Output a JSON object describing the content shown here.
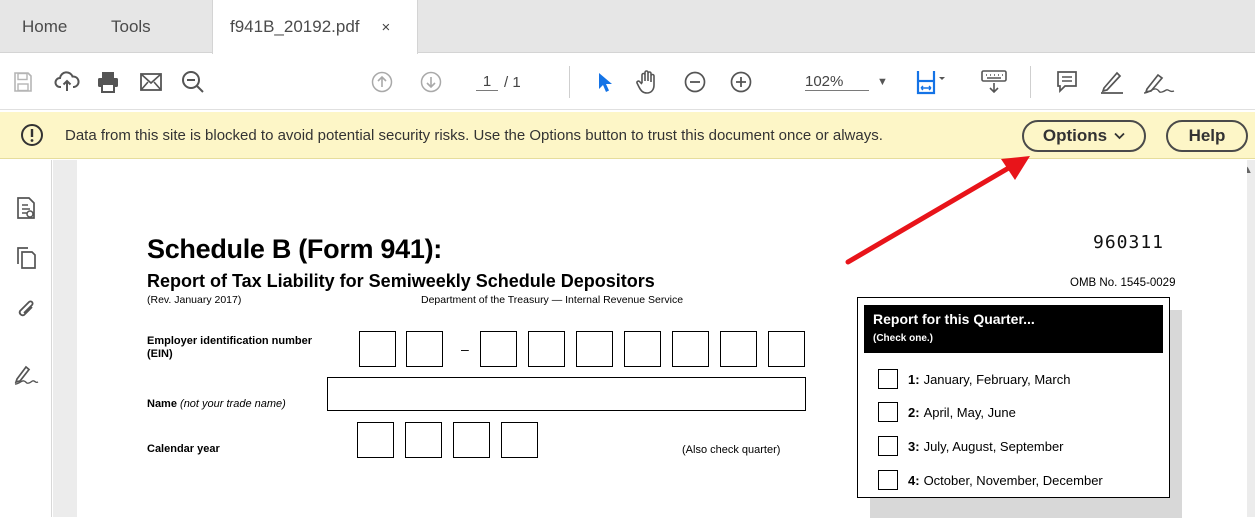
{
  "tabs": {
    "home": "Home",
    "tools": "Tools",
    "document": "f941B_20192.pdf",
    "close": "×"
  },
  "toolbar": {
    "page_current": "1",
    "page_total": "/ 1",
    "zoom": "102%",
    "icons": [
      "save-icon",
      "cloud-upload-icon",
      "print-icon",
      "email-icon",
      "search-zoom-icon",
      "page-up-icon",
      "page-down-icon",
      "select-arrow-icon",
      "hand-tool-icon",
      "zoom-out-icon",
      "zoom-in-icon",
      "fit-page-icon",
      "keyboard-icon",
      "comment-icon",
      "highlight-pen-icon",
      "sign-icon"
    ]
  },
  "security_bar": {
    "message": "Data from this site is blocked to avoid potential security risks. Use the Options button to trust this document once or always.",
    "options_label": "Options",
    "help_label": "Help"
  },
  "document": {
    "title": "Schedule B (Form 941):",
    "subtitle": "Report of Tax Liability for Semiweekly Schedule Depositors",
    "revision": "(Rev. January 2017)",
    "department": "Department of the Treasury — Internal Revenue Service",
    "form_code": "960311",
    "omb": "OMB No. 1545-0029",
    "ein_label": "Employer identification number",
    "ein_abbr": "(EIN)",
    "ein_dash": "–",
    "name_label": "Name",
    "name_hint": "(not your trade name)",
    "year_label": "Calendar year",
    "also_check": "(Also check quarter)",
    "quarter": {
      "heading": "Report for this Quarter...",
      "subheading": "(Check one.)",
      "options": [
        {
          "num": "1:",
          "text": "January, February, March"
        },
        {
          "num": "2:",
          "text": "April, May, June"
        },
        {
          "num": "3:",
          "text": "July, August, September"
        },
        {
          "num": "4:",
          "text": "October, November, December"
        }
      ]
    }
  },
  "colors": {
    "security_bar_bg": "#fdf6c7",
    "select_tool_blue": "#1473e6",
    "annotation_arrow": "#e8141a"
  }
}
